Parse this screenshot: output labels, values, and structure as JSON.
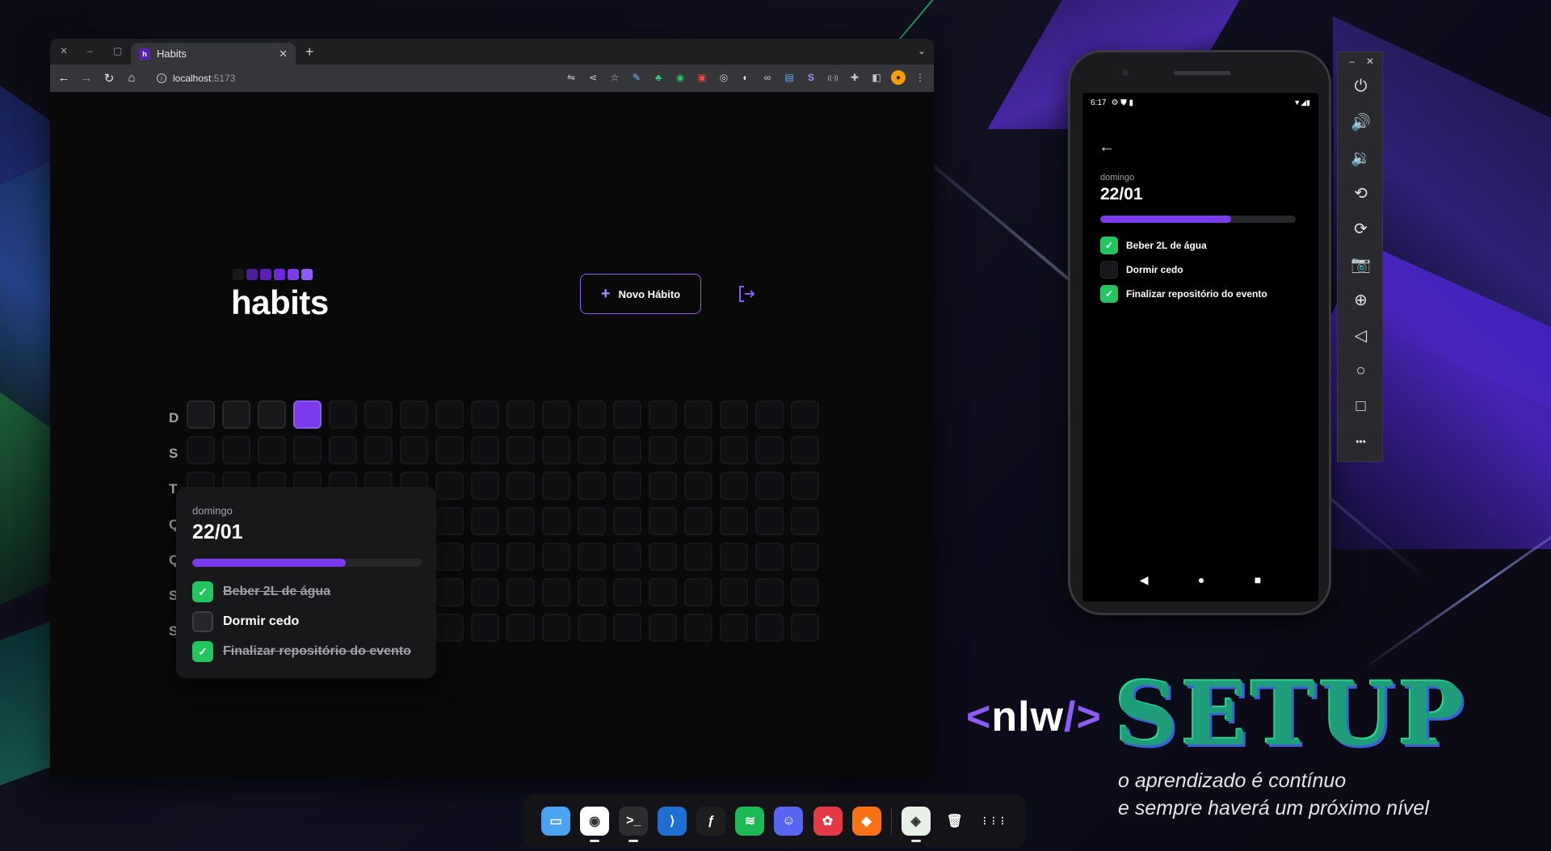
{
  "browser": {
    "tab_title": "Habits",
    "tab_favicon": "h",
    "url_host": "localhost",
    "url_port": ":5173",
    "window_controls": [
      "✕",
      "–",
      "▢"
    ],
    "extensions": [
      {
        "name": "translate-icon",
        "glyph": "⇋"
      },
      {
        "name": "share-icon",
        "glyph": "⋖"
      },
      {
        "name": "bookmark-star-icon",
        "glyph": "☆"
      },
      {
        "name": "eyedropper-extension-icon",
        "glyph": "✎"
      },
      {
        "name": "tree-extension-icon",
        "glyph": "♣"
      },
      {
        "name": "green-circle-extension-icon",
        "glyph": "◉"
      },
      {
        "name": "red-extension-icon",
        "glyph": "▣"
      },
      {
        "name": "target-extension-icon",
        "glyph": "◎"
      },
      {
        "name": "bird-extension-icon",
        "glyph": "◐"
      },
      {
        "name": "owl-extension-icon",
        "glyph": "∞"
      },
      {
        "name": "blue-extension-icon",
        "glyph": "▤"
      },
      {
        "name": "s-badge-extension-icon",
        "glyph": "S"
      },
      {
        "name": "broadcast-extension-icon",
        "glyph": "((·))"
      },
      {
        "name": "puzzle-extensions-icon",
        "glyph": "✚"
      },
      {
        "name": "sidepanel-icon",
        "glyph": "◧"
      }
    ],
    "profile_initial": "●",
    "menu_glyph": "⋮"
  },
  "app": {
    "logo_text": "habits",
    "logo_square_colors": [
      "#18181b",
      "#4c1d95",
      "#5b21b6",
      "#6d28d9",
      "#7c3aed",
      "#8b5cf6"
    ],
    "new_habit_label": "Novo Hábito",
    "week_days": [
      "D",
      "S",
      "T",
      "Q",
      "Q",
      "S",
      "S"
    ],
    "grid_columns": 18,
    "grid_rows": 7,
    "active_cells": [
      [
        0,
        3
      ],
      [
        6,
        2
      ]
    ],
    "colors": {
      "accent": "#7c3aed",
      "check": "#22c55e",
      "bg": "#09090a"
    }
  },
  "popover": {
    "day_name": "domingo",
    "date": "22/01",
    "progress_fraction": 0.67,
    "habits": [
      {
        "label": "Beber 2L de água",
        "done": true
      },
      {
        "label": "Dormir cedo",
        "done": false
      },
      {
        "label": "Finalizar repositório do evento",
        "done": true
      }
    ]
  },
  "phone": {
    "time": "6:17",
    "status_icons_left": "⚙ ⛊ ▮",
    "status_icons_right": "▼◢▮",
    "day_name": "domingo",
    "date": "22/01",
    "progress_fraction": 0.67,
    "habits": [
      {
        "label": "Beber 2L de água",
        "done": true
      },
      {
        "label": "Dormir cedo",
        "done": false
      },
      {
        "label": "Finalizar repositório do evento",
        "done": true
      }
    ],
    "nav": [
      "◀",
      "●",
      "■"
    ]
  },
  "emulator_toolbar": {
    "top_controls": [
      "–",
      "✕"
    ],
    "buttons": [
      {
        "name": "power-icon",
        "glyph": "⏻"
      },
      {
        "name": "volume-up-icon",
        "glyph": "🔊"
      },
      {
        "name": "volume-down-icon",
        "glyph": "🔉"
      },
      {
        "name": "rotate-left-icon",
        "glyph": "⟲"
      },
      {
        "name": "rotate-right-icon",
        "glyph": "⟳"
      },
      {
        "name": "camera-icon",
        "glyph": "📷"
      },
      {
        "name": "zoom-icon",
        "glyph": "⊕"
      },
      {
        "name": "back-icon",
        "glyph": "◁"
      },
      {
        "name": "home-icon",
        "glyph": "○"
      },
      {
        "name": "overview-icon",
        "glyph": "□"
      },
      {
        "name": "more-icon",
        "glyph": "•••"
      }
    ]
  },
  "branding": {
    "nlw_open": "<",
    "nlw_text": "nlw",
    "nlw_close": "/>",
    "setup": "SETUP",
    "tagline_line1": "o aprendizado é contínuo",
    "tagline_line2": "e sempre haverá um próximo nível"
  },
  "dock": {
    "items": [
      {
        "name": "files-app-icon",
        "glyph": "▭",
        "bg": "#4aa3f0",
        "running": false
      },
      {
        "name": "chrome-app-icon",
        "glyph": "◉",
        "bg": "#ffffff",
        "running": true
      },
      {
        "name": "terminal-app-icon",
        "glyph": ">_",
        "bg": "#2d2d30",
        "running": true
      },
      {
        "name": "vscode-app-icon",
        "glyph": "⟩",
        "bg": "#1f6fd0",
        "running": false
      },
      {
        "name": "figma-app-icon",
        "glyph": "ƒ",
        "bg": "#1e1e1e",
        "running": false
      },
      {
        "name": "spotify-app-icon",
        "glyph": "≋",
        "bg": "#1db954",
        "running": false
      },
      {
        "name": "discord-app-icon",
        "glyph": "☺",
        "bg": "#5865f2",
        "running": false
      },
      {
        "name": "photos-app-icon",
        "glyph": "✿",
        "bg": "#e63946",
        "running": false
      },
      {
        "name": "brave-app-icon",
        "glyph": "◆",
        "bg": "#f97316",
        "running": false
      },
      {
        "name": "android-studio-app-icon",
        "glyph": "◈",
        "bg": "#e8f0e8",
        "running": true
      },
      {
        "name": "trash-app-icon",
        "glyph": "🗑",
        "bg": "transparent",
        "running": false
      },
      {
        "name": "app-grid-icon",
        "glyph": "⋮⋮⋮",
        "bg": "transparent",
        "running": false
      }
    ]
  }
}
